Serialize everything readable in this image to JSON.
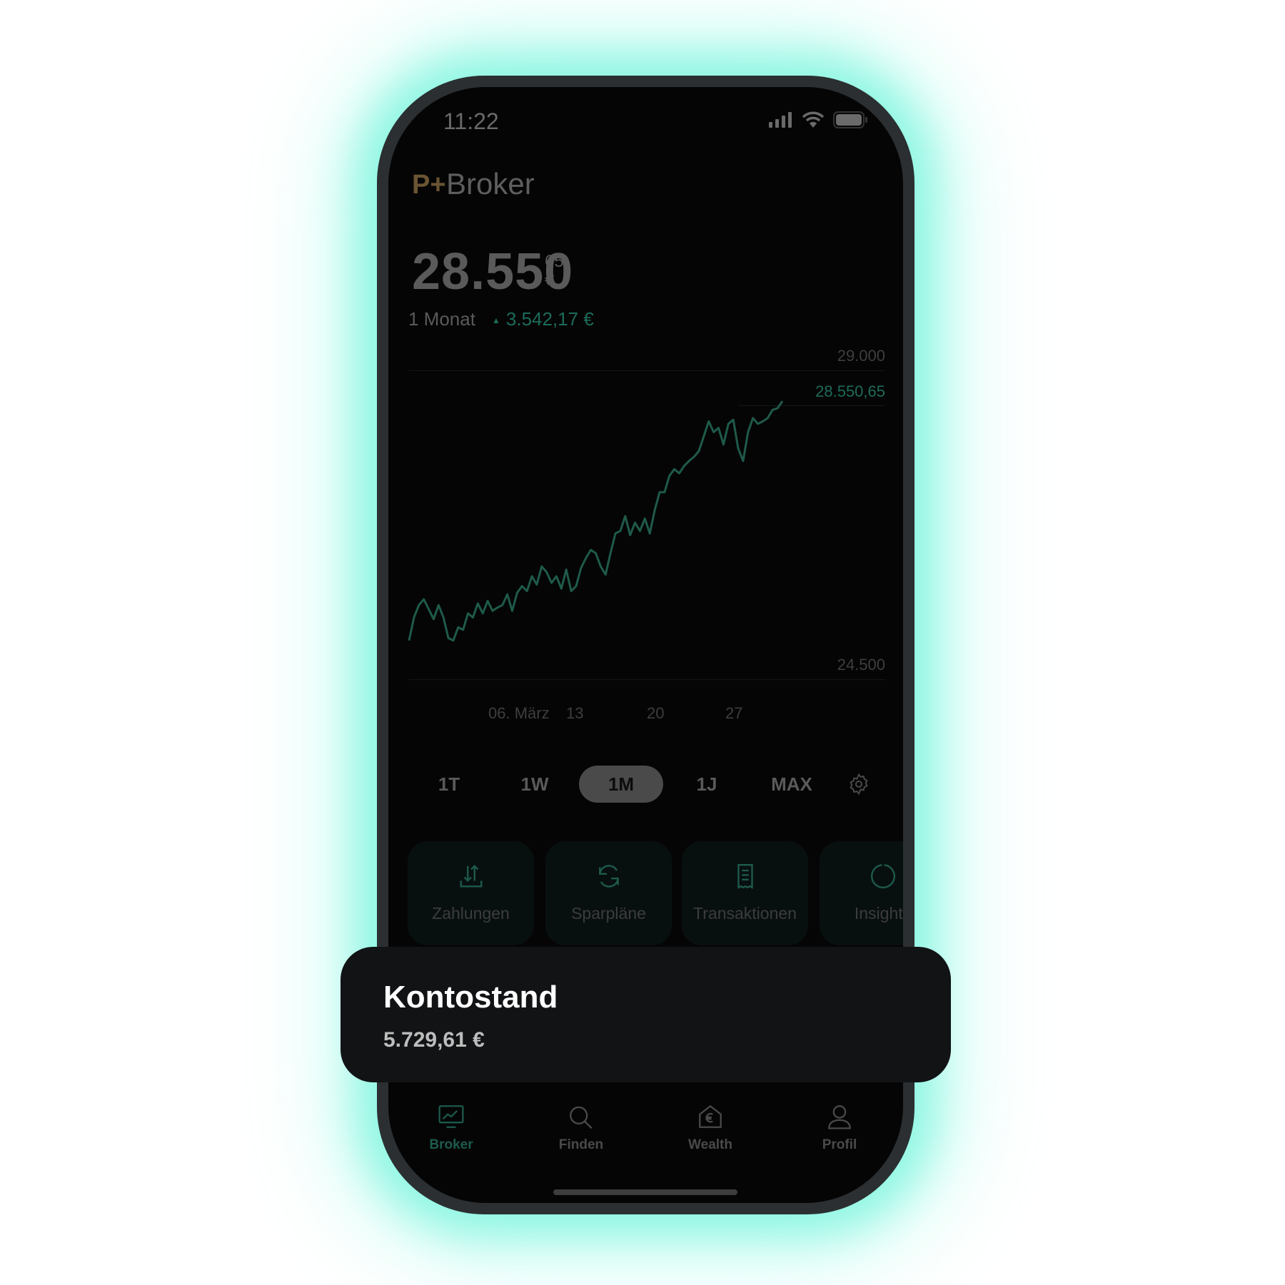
{
  "status_bar": {
    "time": "11:22",
    "icons": [
      "signal-icon",
      "wifi-icon",
      "battery-icon"
    ]
  },
  "header": {
    "logo": "P+",
    "title": "Broker"
  },
  "balance": {
    "main": "28.550",
    "cents": "65",
    "currency": "€"
  },
  "performance": {
    "period": "1 Monat",
    "arrow": "▲",
    "change": "3.542,17 €"
  },
  "colors": {
    "accent_green": "#1d6b5a",
    "line": "#1f5a4a",
    "logo": "#6a5432",
    "glow": "#50f0d2"
  },
  "chart_data": {
    "type": "line",
    "ylim": [
      24500,
      29000
    ],
    "y_ticks": [
      "29.000",
      "24.500"
    ],
    "x_ticks": [
      "06. März",
      "13",
      "20",
      "27"
    ],
    "current_label": "28.550,65",
    "grid": true,
    "values": [
      25064,
      25400,
      25580,
      25664,
      25520,
      25376,
      25580,
      25400,
      25100,
      25064,
      25256,
      25220,
      25460,
      25400,
      25604,
      25460,
      25640,
      25496,
      25544,
      25580,
      25736,
      25496,
      25760,
      25856,
      25784,
      26000,
      25880,
      26144,
      26060,
      25904,
      26000,
      25820,
      26096,
      25784,
      25856,
      26120,
      26264,
      26384,
      26336,
      26144,
      26024,
      26336,
      26624,
      26660,
      26876,
      26600,
      26780,
      26660,
      26840,
      26624,
      26960,
      27224,
      27224,
      27464,
      27560,
      27500,
      27608,
      27680,
      27740,
      27824,
      28040,
      28256,
      28100,
      28160,
      27920,
      28220,
      28280,
      27860,
      27680,
      28100,
      28304,
      28220,
      28256,
      28304,
      28424,
      28448,
      28550.65
    ]
  },
  "periods": [
    {
      "label": "1T",
      "active": false
    },
    {
      "label": "1W",
      "active": false
    },
    {
      "label": "1M",
      "active": true
    },
    {
      "label": "1J",
      "active": false
    },
    {
      "label": "MAX",
      "active": false
    }
  ],
  "actions": [
    {
      "label": "Zahlungen",
      "icon": "transfer-icon"
    },
    {
      "label": "Sparpläne",
      "icon": "refresh-icon"
    },
    {
      "label": "Transaktionen",
      "icon": "receipt-icon"
    },
    {
      "label": "Insights",
      "icon": "donut-icon"
    }
  ],
  "sheet": {
    "title": "Kontostand",
    "value": "5.729,61 €"
  },
  "tabs": [
    {
      "label": "Broker",
      "icon": "chart-monitor-icon",
      "active": true
    },
    {
      "label": "Finden",
      "icon": "search-icon",
      "active": false
    },
    {
      "label": "Wealth",
      "icon": "euro-house-icon",
      "active": false
    },
    {
      "label": "Profil",
      "icon": "person-icon",
      "active": false
    }
  ]
}
